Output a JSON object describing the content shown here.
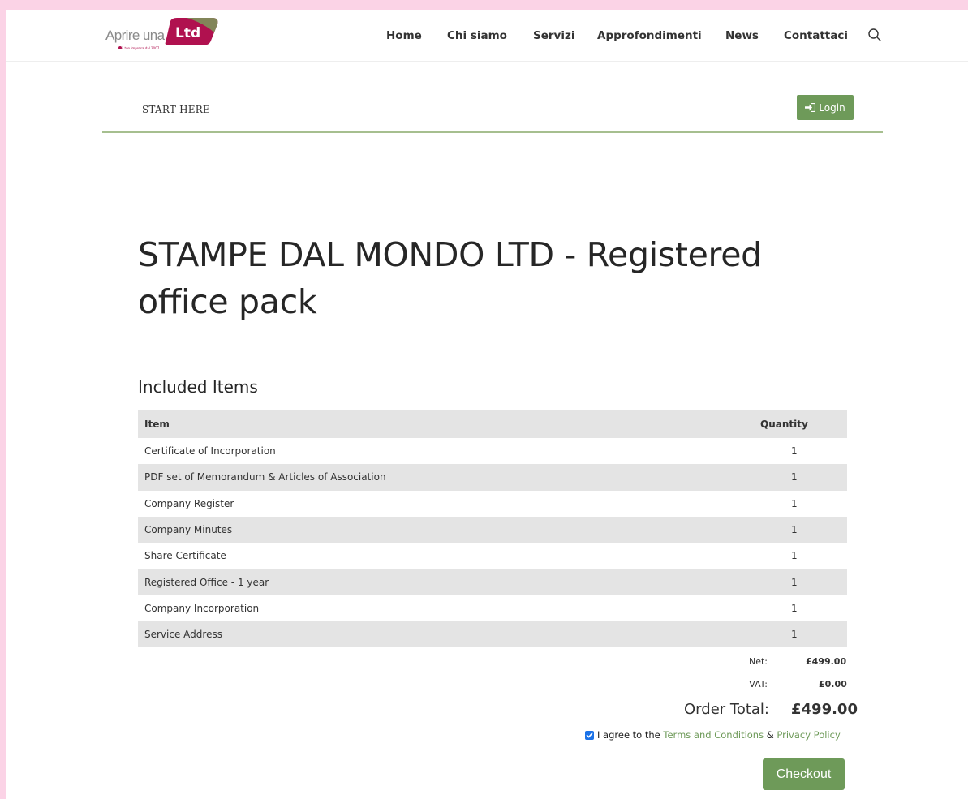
{
  "brand": {
    "logo_text": "Aprire una",
    "logo_badge": "Ltd",
    "logo_tagline": "il tuo impresa dal 2007"
  },
  "nav": {
    "items": [
      "Home",
      "Chi siamo",
      "Servizi",
      "Approfondimenti",
      "News",
      "Contattaci"
    ]
  },
  "subbar": {
    "start_here": "START HERE",
    "login_label": "Login"
  },
  "product": {
    "title": "STAMPE DAL MONDO LTD - Registered office pack"
  },
  "included": {
    "heading": "Included Items",
    "columns": [
      "Item",
      "Quantity"
    ],
    "rows": [
      {
        "item": "Certificate of Incorporation",
        "qty": "1"
      },
      {
        "item": "PDF set of Memorandum & Articles of Association",
        "qty": "1"
      },
      {
        "item": "Company Register",
        "qty": "1"
      },
      {
        "item": "Company Minutes",
        "qty": "1"
      },
      {
        "item": "Share Certificate",
        "qty": "1"
      },
      {
        "item": "Registered Office - 1 year",
        "qty": "1"
      },
      {
        "item": "Company Incorporation",
        "qty": "1"
      },
      {
        "item": "Service Address",
        "qty": "1"
      }
    ]
  },
  "totals": {
    "net_label": "Net:",
    "net_value": "£499.00",
    "vat_label": "VAT:",
    "vat_value": "£0.00",
    "order_total_label": "Order Total:",
    "order_total_value": "£499.00"
  },
  "agreement": {
    "checked": true,
    "prefix": "I agree to the ",
    "terms_link": "Terms and Conditions",
    "joiner": " & ",
    "privacy_link": "Privacy Policy"
  },
  "checkout": {
    "label": "Checkout"
  },
  "colors": {
    "page_bg": "#fbd3e6",
    "accent_green": "#6e9a59",
    "brand_magenta": "#b0114f",
    "row_stripe": "#e4e4e4"
  }
}
